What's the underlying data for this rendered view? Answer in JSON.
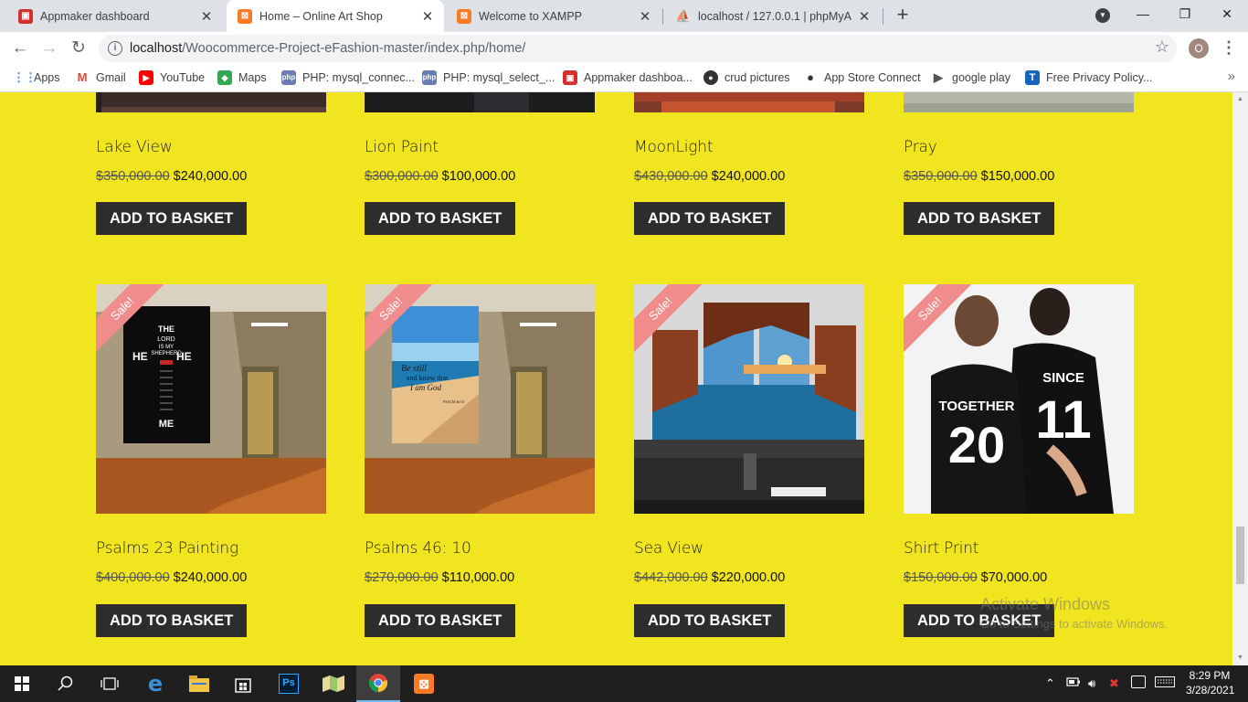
{
  "browser": {
    "tabs": [
      {
        "title": "Appmaker dashboard",
        "icon": "appmaker-icon",
        "active": false
      },
      {
        "title": "Home – Online Art Shop",
        "icon": "xampp-icon",
        "active": true
      },
      {
        "title": "Welcome to XAMPP",
        "icon": "xampp-icon",
        "active": false
      },
      {
        "title": "localhost / 127.0.0.1 | phpMyAdmin",
        "icon": "phpmyadmin-icon",
        "active": false
      }
    ],
    "new_tab": "+",
    "window": {
      "minimize": "—",
      "maximize": "❐",
      "close": "✕"
    },
    "url_host": "localhost",
    "url_path": "/Woocommerce-Project-eFashion-master/index.php/home/",
    "profile_initial": "O"
  },
  "bookmarks": [
    {
      "label": "Apps",
      "icon": "apps-grid-icon"
    },
    {
      "label": "Gmail",
      "icon": "gmail-icon"
    },
    {
      "label": "YouTube",
      "icon": "youtube-icon"
    },
    {
      "label": "Maps",
      "icon": "maps-icon"
    },
    {
      "label": "PHP: mysql_connec...",
      "icon": "php-icon"
    },
    {
      "label": "PHP: mysql_select_...",
      "icon": "php-icon"
    },
    {
      "label": "Appmaker dashboa...",
      "icon": "appmaker-icon"
    },
    {
      "label": "crud pictures",
      "icon": "github-icon"
    },
    {
      "label": "App Store Connect",
      "icon": "apple-icon"
    },
    {
      "label": "google play",
      "icon": "google-play-icon"
    },
    {
      "label": "Free Privacy Policy...",
      "icon": "t-icon"
    }
  ],
  "products_row1": [
    {
      "name": "Lake View",
      "old_price": "$350,000.00",
      "new_price": "$240,000.00",
      "button": "ADD TO BASKET"
    },
    {
      "name": "Lion Paint",
      "old_price": "$300,000.00",
      "new_price": "$100,000.00",
      "button": "ADD TO BASKET"
    },
    {
      "name": "MoonLight",
      "old_price": "$430,000.00",
      "new_price": "$240,000.00",
      "button": "ADD TO BASKET"
    },
    {
      "name": "Pray",
      "old_price": "$350,000.00",
      "new_price": "$150,000.00",
      "button": "ADD TO BASKET"
    }
  ],
  "products_row2": [
    {
      "name": "Psalms 23 Painting",
      "old_price": "$400,000.00",
      "new_price": "$240,000.00",
      "button": "ADD TO BASKET",
      "badge": "Sale!"
    },
    {
      "name": "Psalms 46: 10",
      "old_price": "$270,000.00",
      "new_price": "$110,000.00",
      "button": "ADD TO BASKET",
      "badge": "Sale!"
    },
    {
      "name": "Sea View",
      "old_price": "$442,000.00",
      "new_price": "$220,000.00",
      "button": "ADD TO BASKET",
      "badge": "Sale!"
    },
    {
      "name": "Shirt Print",
      "old_price": "$150,000.00",
      "new_price": "$70,000.00",
      "button": "ADD TO BASKET",
      "badge": "Sale!"
    }
  ],
  "artwork_text": {
    "cross_words": [
      "THE",
      "LORD",
      "IS MY",
      "SHEPHERD",
      "HE",
      "HE",
      "ME"
    ],
    "verse_lines": [
      "Be still",
      "and know that",
      "I am God"
    ],
    "verse_ref": "PSALM 46:10",
    "shirt_left_word": "TOGETHER",
    "shirt_left_number": "20",
    "shirt_right_word": "SINCE",
    "shirt_right_number": "11"
  },
  "activation": {
    "title": "Activate Windows",
    "subtitle": "Go to Settings to activate Windows."
  },
  "taskbar": {
    "time": "8:29 PM",
    "date": "3/28/2021"
  },
  "colors": {
    "page_background": "#f1e520",
    "button_background": "#2d2d2d",
    "sale_ribbon": "#f08c8c"
  }
}
